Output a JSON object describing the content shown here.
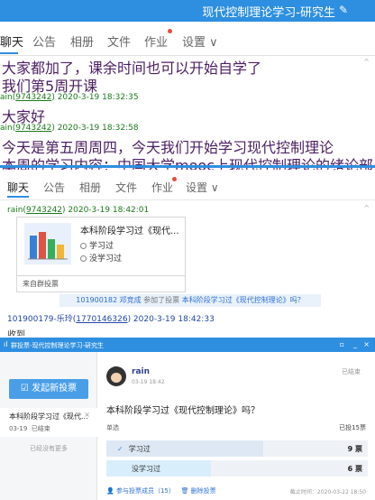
{
  "panel1": {
    "window_title": "现代控制理论学习-研究生",
    "tabs": [
      {
        "label": "聊天"
      },
      {
        "label": "公告"
      },
      {
        "label": "相册"
      },
      {
        "label": "文件"
      },
      {
        "label": "作业"
      },
      {
        "label": "设置 ∨"
      }
    ],
    "messages": [
      {
        "kind": "text",
        "text": "大家都加了，课余时间也可以开始自学了"
      },
      {
        "kind": "text",
        "text": "我们第5周开课"
      },
      {
        "kind": "meta",
        "name_prefix": "ain(",
        "id": "9743242",
        "suffix": ") 2020-3-19 18:32:35"
      },
      {
        "kind": "text",
        "text": "大家好"
      },
      {
        "kind": "meta",
        "name_prefix": "ain(",
        "id": "9743242",
        "suffix": ") 2020-3-19 18:32:58"
      },
      {
        "kind": "text",
        "text": "今天是第五周周四，今天我们开始学习现代控制理论"
      },
      {
        "kind": "text",
        "text": "本周的学习内容：中国大学mooc上现代控制理论的绪论部"
      }
    ]
  },
  "panel2": {
    "tabs": [
      {
        "label": "聊天"
      },
      {
        "label": "公告"
      },
      {
        "label": "相册"
      },
      {
        "label": "文件"
      },
      {
        "label": "作业"
      },
      {
        "label": "设置 ∨"
      }
    ],
    "meta1": {
      "prefix": "rain(",
      "id": "9743242",
      "suffix": ") 2020-3-19 18:42:01"
    },
    "card": {
      "title": "本科阶段学习过《现代...",
      "option1": "学习过",
      "option2": "没学习过",
      "footer": "来自群投票"
    },
    "notice": {
      "user": "101900182 邓竞成",
      "action": " 参加了投票 ",
      "topic": "本科阶段学习过《现代控制理论》吗？"
    },
    "meta2": {
      "prefix": "101900179-乐玲(",
      "id": "1770146326",
      "suffix": ") 2020-3-19 18:42:33"
    },
    "tail": "收到"
  },
  "panel3": {
    "window_title": "群投票-现代控制理论学习-研究生",
    "new_vote_button": "发起新投票",
    "list_item": {
      "title": "本科阶段学习过《现代...",
      "date": "03-19",
      "status": "已结束"
    },
    "no_more": "已经没有更多",
    "author": "rain",
    "time": "03-19 18:42",
    "ended": "已结束",
    "question": "本科阶段学习过《现代控制理论》吗？",
    "type": "单选",
    "voted": "已投15票",
    "options": [
      {
        "label": "学习过",
        "count": "9 票",
        "fraction": 0.6
      },
      {
        "label": "没学习过",
        "count": "6 票",
        "fraction": 0.4
      }
    ],
    "participants": "参与投票成员（15）",
    "delete": "删除投票",
    "deadline": "截止时间：2020-03-22 18:50"
  }
}
